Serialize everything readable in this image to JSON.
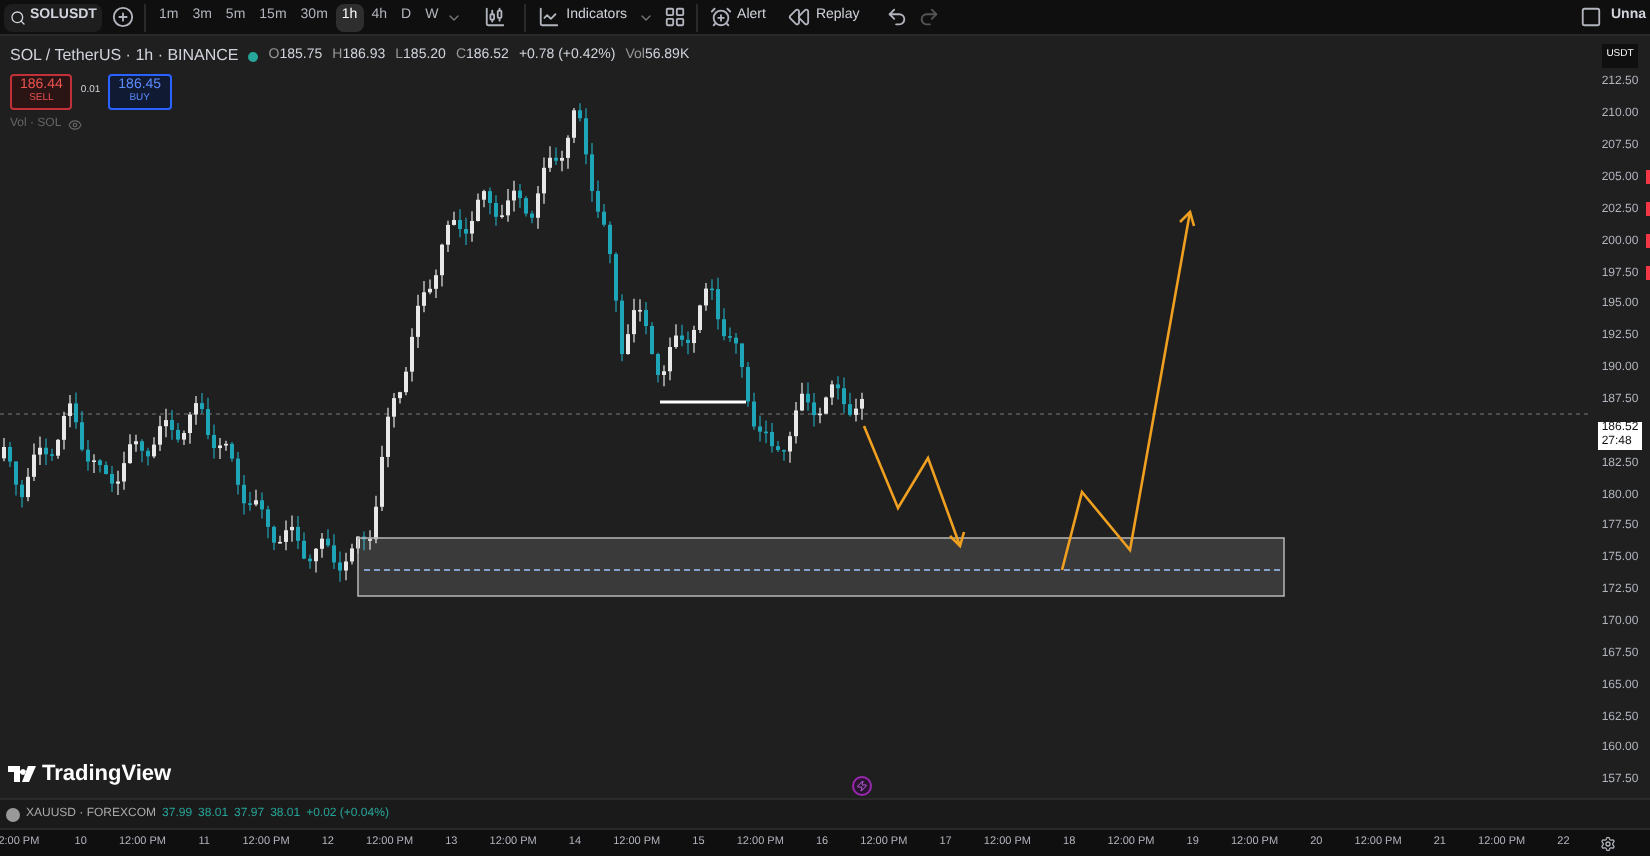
{
  "toolbar": {
    "symbol": "SOLUSDT",
    "intervals": [
      {
        "label": "1m",
        "selected": false
      },
      {
        "label": "3m",
        "selected": false
      },
      {
        "label": "5m",
        "selected": false
      },
      {
        "label": "15m",
        "selected": false
      },
      {
        "label": "30m",
        "selected": false
      },
      {
        "label": "1h",
        "selected": true
      },
      {
        "label": "4h",
        "selected": false
      },
      {
        "label": "D",
        "selected": false
      },
      {
        "label": "W",
        "selected": false
      }
    ],
    "indicators": "Indicators",
    "alert": "Alert",
    "replay": "Replay",
    "layout_name": "Unna"
  },
  "legend": {
    "title": "SOL / TetherUS · 1h · BINANCE",
    "ohlc": [
      {
        "label": "O",
        "value": "185.75"
      },
      {
        "label": "H",
        "value": "186.93"
      },
      {
        "label": "L",
        "value": "185.20"
      },
      {
        "label": "C",
        "value": "186.52"
      }
    ],
    "change": "+0.78 (+0.42%)",
    "volume_label": "Vol",
    "volume": "56.89K"
  },
  "trade": {
    "sell_price": "186.44",
    "sell_label": "SELL",
    "spread": "0.01",
    "buy_price": "186.45",
    "buy_label": "BUY"
  },
  "volume_indicator": "Vol · SOL",
  "price_axis": {
    "currency": "USDT",
    "labels": [
      {
        "kind": "label",
        "text": "212.50"
      },
      {
        "kind": "label",
        "text": "210.00"
      },
      {
        "kind": "label",
        "text": "207.50"
      },
      {
        "kind": "label",
        "text": "205.00"
      },
      {
        "kind": "label",
        "text": "202.50"
      },
      {
        "kind": "label",
        "text": "200.00"
      },
      {
        "kind": "label",
        "text": "197.50"
      },
      {
        "kind": "label",
        "text": "195.00"
      },
      {
        "kind": "label",
        "text": "192.50"
      },
      {
        "kind": "label",
        "text": "190.00"
      },
      {
        "kind": "label",
        "text": "187.50"
      },
      {
        "kind": "current",
        "price": "186.52",
        "countdown": "27:48"
      },
      {
        "kind": "label",
        "text": "182.50"
      },
      {
        "kind": "label",
        "text": "180.00"
      },
      {
        "kind": "label",
        "text": "177.50"
      },
      {
        "kind": "label",
        "text": "175.00"
      },
      {
        "kind": "label",
        "text": "172.50"
      },
      {
        "kind": "label",
        "text": "170.00"
      },
      {
        "kind": "label",
        "text": "167.50"
      },
      {
        "kind": "label",
        "text": "165.00"
      },
      {
        "kind": "label",
        "text": "162.50"
      },
      {
        "kind": "label",
        "text": "160.00"
      },
      {
        "kind": "label",
        "text": "157.50"
      }
    ]
  },
  "brand": "TradingView",
  "compare_symbol": {
    "name": "XAUUSD · FOREXCOM",
    "values": [
      "37.99",
      "38.01",
      "37.97",
      "38.01",
      "+0.02 (+0.04%)"
    ]
  },
  "time_axis": [
    "2:00 PM",
    "10",
    "12:00 PM",
    "11",
    "12:00 PM",
    "12",
    "12:00 PM",
    "13",
    "12:00 PM",
    "14",
    "12:00 PM",
    "15",
    "12:00 PM",
    "16",
    "12:00 PM",
    "17",
    "12:00 PM",
    "18",
    "12:00 PM",
    "19",
    "12:00 PM",
    "20",
    "12:00 PM",
    "21",
    "12:00 PM",
    "22"
  ]
}
